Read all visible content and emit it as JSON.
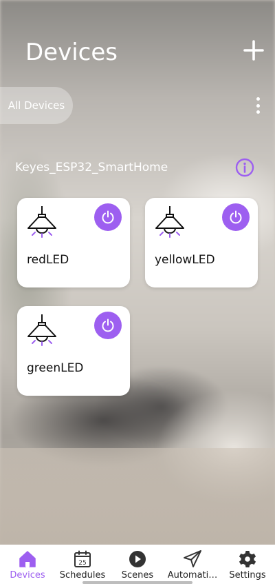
{
  "header": {
    "title": "Devices",
    "add_icon": "plus-icon"
  },
  "filter": {
    "chip_label": "All Devices",
    "more_icon": "more-vertical-icon"
  },
  "home": {
    "name": "Keyes_ESP32_SmartHome",
    "info_icon": "info-icon"
  },
  "devices": [
    {
      "name": "redLED",
      "icon": "ceiling-lamp-icon",
      "power_icon": "power-icon"
    },
    {
      "name": "yellowLED",
      "icon": "ceiling-lamp-icon",
      "power_icon": "power-icon"
    },
    {
      "name": "greenLED",
      "icon": "ceiling-lamp-icon",
      "power_icon": "power-icon"
    }
  ],
  "nav": {
    "items": [
      {
        "label": "Devices",
        "icon": "home-icon",
        "active": true
      },
      {
        "label": "Schedules",
        "icon": "calendar-icon",
        "calendar_day": "25",
        "active": false
      },
      {
        "label": "Scenes",
        "icon": "play-icon",
        "active": false
      },
      {
        "label": "Automati…",
        "icon": "send-icon",
        "active": false
      },
      {
        "label": "Settings",
        "icon": "gear-icon",
        "active": false
      }
    ]
  },
  "colors": {
    "accent": "#9d5ff0",
    "card_bg": "#ffffff",
    "text_light": "#ffffff",
    "text_dark": "#111111"
  }
}
